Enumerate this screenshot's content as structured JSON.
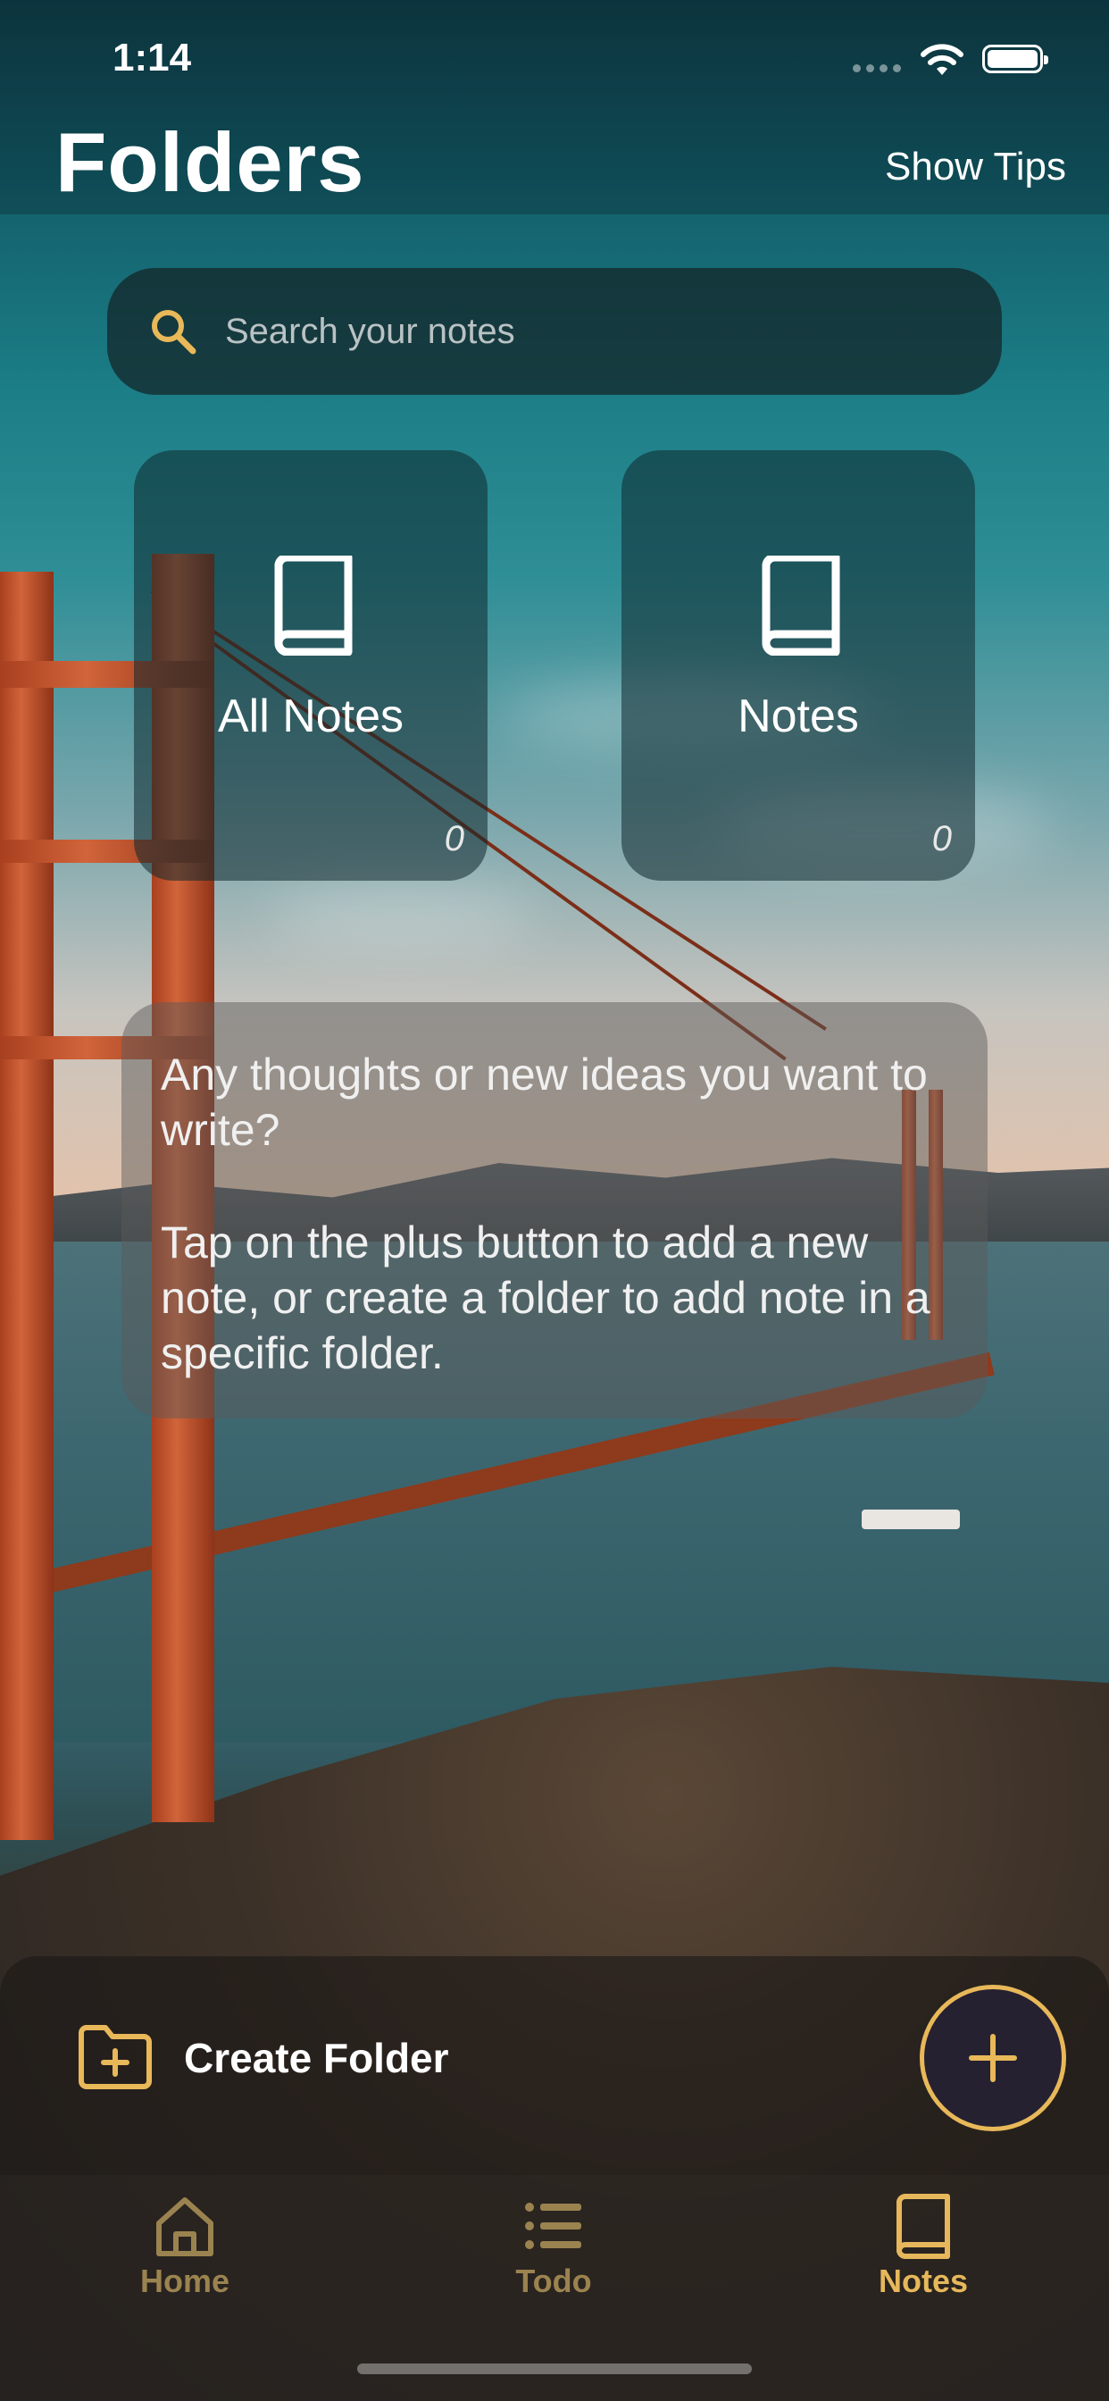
{
  "status_bar": {
    "time": "1:14"
  },
  "header": {
    "title": "Folders",
    "tips_button": "Show Tips"
  },
  "search": {
    "placeholder": "Search your notes",
    "icon": "search-icon"
  },
  "folders": [
    {
      "name": "All Notes",
      "count": "0",
      "icon": "book-icon"
    },
    {
      "name": "Notes",
      "count": "0",
      "icon": "book-icon"
    }
  ],
  "tip": {
    "paragraph1": "Any thoughts or new ideas you want to write?",
    "paragraph2": "Tap on the plus button to add a new note, or create a folder to add note in a specific folder."
  },
  "actions": {
    "create_folder": "Create Folder",
    "add_icon": "plus-icon"
  },
  "tabs": [
    {
      "label": "Home",
      "icon": "home-icon",
      "active": false
    },
    {
      "label": "Todo",
      "icon": "list-icon",
      "active": false
    },
    {
      "label": "Notes",
      "icon": "book-icon",
      "active": true
    }
  ],
  "colors": {
    "accent": "#e8b859",
    "tab_inactive": "#9b8350"
  }
}
